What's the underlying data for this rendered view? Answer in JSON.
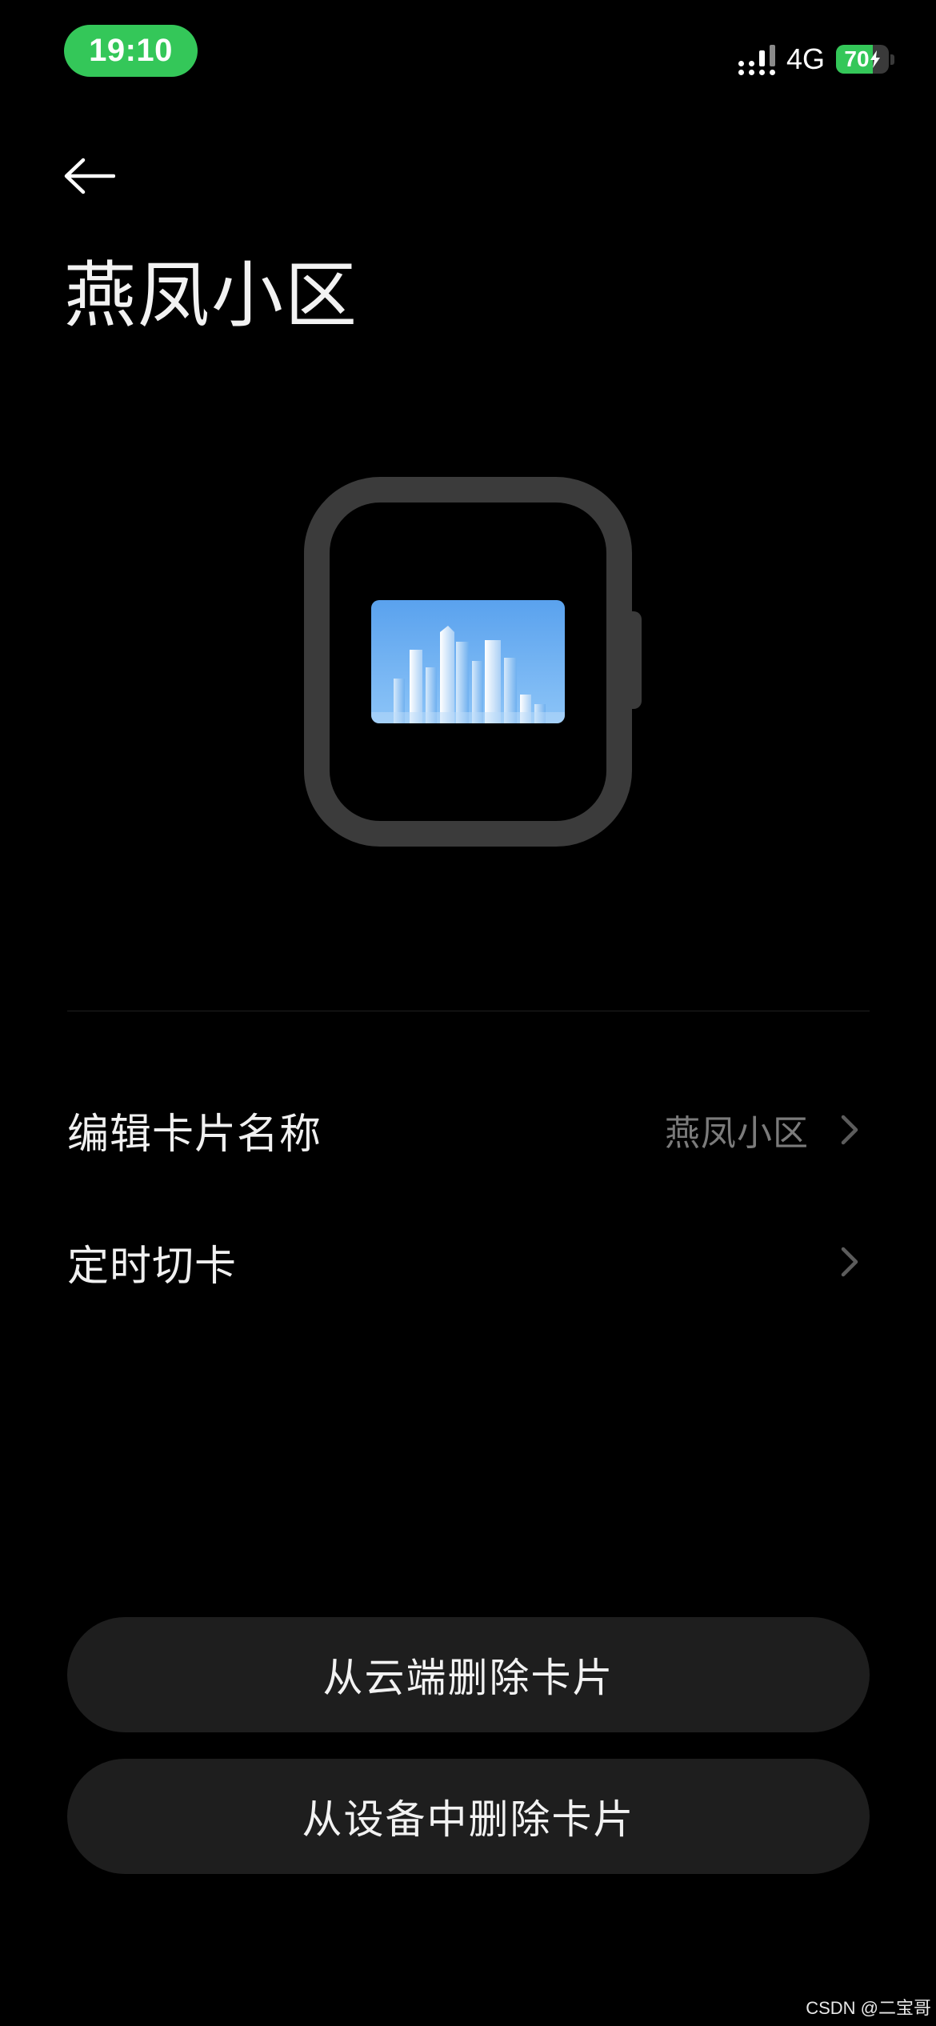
{
  "status_bar": {
    "time": "19:10",
    "network_type": "4G",
    "battery_level": "70",
    "battery_charging": true,
    "accent_color": "#34c759"
  },
  "header": {
    "back_icon": "arrow-left-icon",
    "title": "燕凤小区"
  },
  "card_preview": {
    "device_icon": "smartwatch-icon",
    "card_image": "city-buildings-card-image"
  },
  "settings": {
    "edit_name": {
      "label": "编辑卡片名称",
      "value": "燕凤小区",
      "icon": "chevron-right-icon"
    },
    "schedule_switch": {
      "label": "定时切卡",
      "icon": "chevron-right-icon"
    }
  },
  "actions": {
    "delete_cloud_label": "从云端删除卡片",
    "delete_device_label": "从设备中删除卡片"
  },
  "watermark": "CSDN @二宝哥"
}
